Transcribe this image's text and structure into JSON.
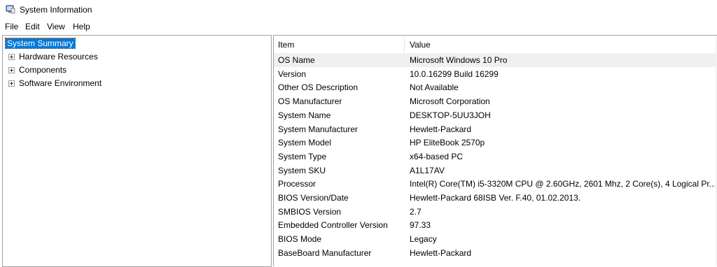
{
  "window": {
    "title": "System Information",
    "icon": "system-information-icon"
  },
  "menu": {
    "items": [
      "File",
      "Edit",
      "View",
      "Help"
    ]
  },
  "tree": {
    "items": [
      {
        "label": "System Summary",
        "selected": true,
        "expandable": false
      },
      {
        "label": "Hardware Resources",
        "selected": false,
        "expandable": true
      },
      {
        "label": "Components",
        "selected": false,
        "expandable": true
      },
      {
        "label": "Software Environment",
        "selected": false,
        "expandable": true
      }
    ]
  },
  "details": {
    "headers": {
      "item": "Item",
      "value": "Value"
    },
    "rows": [
      {
        "item": "OS Name",
        "value": "Microsoft Windows 10 Pro"
      },
      {
        "item": "Version",
        "value": "10.0.16299 Build 16299"
      },
      {
        "item": "Other OS Description",
        "value": "Not Available"
      },
      {
        "item": "OS Manufacturer",
        "value": "Microsoft Corporation"
      },
      {
        "item": "System Name",
        "value": "DESKTOP-5UU3JOH"
      },
      {
        "item": "System Manufacturer",
        "value": "Hewlett-Packard"
      },
      {
        "item": "System Model",
        "value": "HP EliteBook 2570p"
      },
      {
        "item": "System Type",
        "value": "x64-based PC"
      },
      {
        "item": "System SKU",
        "value": "A1L17AV"
      },
      {
        "item": "Processor",
        "value": "Intel(R) Core(TM) i5-3320M CPU @ 2.60GHz, 2601 Mhz, 2 Core(s), 4 Logical Pr..."
      },
      {
        "item": "BIOS Version/Date",
        "value": "Hewlett-Packard 68ISB Ver. F.40, 01.02.2013."
      },
      {
        "item": "SMBIOS Version",
        "value": "2.7"
      },
      {
        "item": "Embedded Controller Version",
        "value": "97.33"
      },
      {
        "item": "BIOS Mode",
        "value": "Legacy"
      },
      {
        "item": "BaseBoard Manufacturer",
        "value": "Hewlett-Packard"
      }
    ]
  },
  "colors": {
    "selection": "#0078d7",
    "highlight_row": "#f0f0f0",
    "border": "#a0a0a0"
  }
}
